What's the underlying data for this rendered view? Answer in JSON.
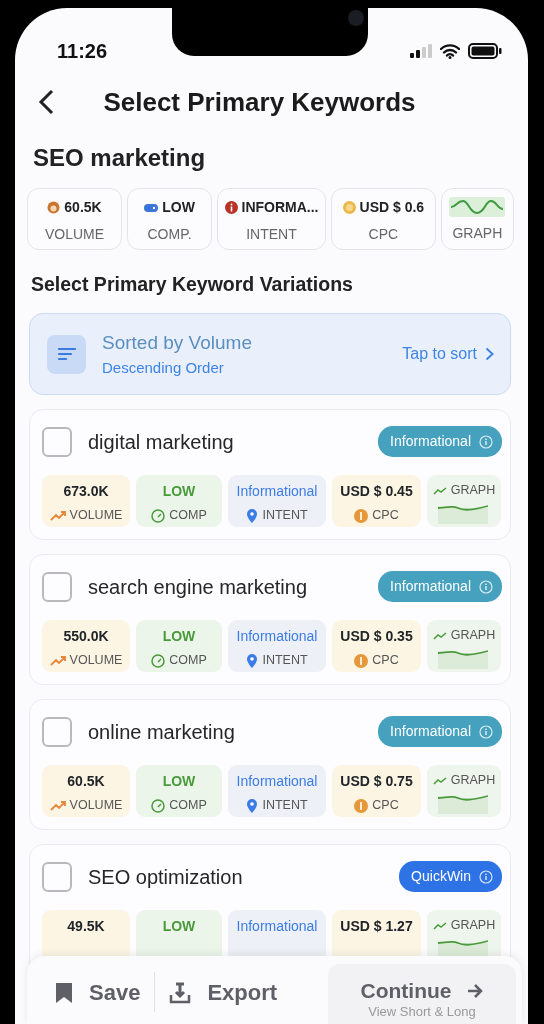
{
  "status_bar": {
    "time": "11:26"
  },
  "header": {
    "title": "Select Primary Keywords"
  },
  "topic": "SEO marketing",
  "summary": [
    {
      "kind": "volume",
      "value": "60.5K",
      "label": "VOLUME"
    },
    {
      "kind": "comp",
      "value": "LOW",
      "label": "COMP."
    },
    {
      "kind": "intent",
      "value": "INFORMA...",
      "label": "INTENT"
    },
    {
      "kind": "cpc",
      "value": "USD $ 0.6",
      "label": "CPC"
    },
    {
      "kind": "graph",
      "label": "GRAPH"
    }
  ],
  "section_title": "Select Primary Keyword Variations",
  "sort": {
    "title": "Sorted by Volume",
    "subtitle": "Descending Order",
    "action": "Tap to sort"
  },
  "keywords": [
    {
      "name": "digital marketing",
      "checked": false,
      "badge": "Informational",
      "color": "#45a1bd",
      "metrics": [
        {
          "kind": "volume",
          "value": "673.0K",
          "label": "VOLUME"
        },
        {
          "kind": "comp",
          "value": "LOW",
          "label": "COMP"
        },
        {
          "kind": "intent",
          "value": "Informational",
          "label": "INTENT"
        },
        {
          "kind": "cpc",
          "value": "USD $ 0.45",
          "label": "CPC"
        },
        {
          "kind": "graph",
          "value": "GRAPH"
        }
      ]
    },
    {
      "name": "search engine marketing",
      "checked": false,
      "badge": "Informational",
      "color": "#45a1bd",
      "metrics": [
        {
          "kind": "volume",
          "value": "550.0K",
          "label": "VOLUME"
        },
        {
          "kind": "comp",
          "value": "LOW",
          "label": "COMP"
        },
        {
          "kind": "intent",
          "value": "Informational",
          "label": "INTENT"
        },
        {
          "kind": "cpc",
          "value": "USD $ 0.35",
          "label": "CPC"
        },
        {
          "kind": "graph",
          "value": "GRAPH"
        }
      ]
    },
    {
      "name": "online marketing",
      "checked": false,
      "badge": "Informational",
      "color": "#45a1bd",
      "metrics": [
        {
          "kind": "volume",
          "value": "60.5K",
          "label": "VOLUME"
        },
        {
          "kind": "comp",
          "value": "LOW",
          "label": "COMP"
        },
        {
          "kind": "intent",
          "value": "Informational",
          "label": "INTENT"
        },
        {
          "kind": "cpc",
          "value": "USD $ 0.75",
          "label": "CPC"
        },
        {
          "kind": "graph",
          "value": "GRAPH"
        }
      ]
    },
    {
      "name": "SEO optimization",
      "checked": false,
      "badge": "QuickWin",
      "color": "#2e73e6",
      "metrics": [
        {
          "kind": "volume",
          "value": "49.5K"
        },
        {
          "kind": "comp",
          "value": "LOW"
        },
        {
          "kind": "intent",
          "value": "Informational"
        },
        {
          "kind": "cpc",
          "value": "USD $ 1.27"
        },
        {
          "kind": "graph",
          "value": "GRAPH"
        }
      ]
    }
  ],
  "bottom_bar": {
    "save": "Save",
    "export": "Export",
    "continue": "Continue",
    "continue_sub": "View Short & Long"
  }
}
